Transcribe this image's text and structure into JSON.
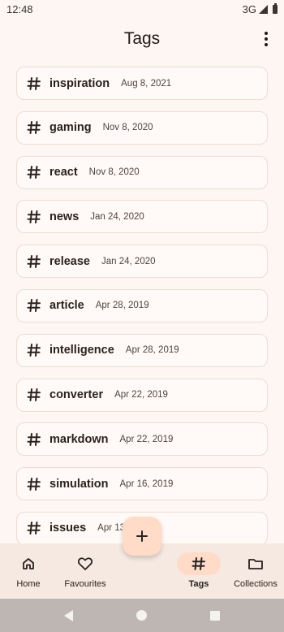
{
  "status_bar": {
    "time": "12:48",
    "network": "3G"
  },
  "app_bar": {
    "title": "Tags",
    "more_icon": "more-vert-icon"
  },
  "tags": [
    {
      "name": "inspiration",
      "date": "Aug 8, 2021"
    },
    {
      "name": "gaming",
      "date": "Nov 8, 2020"
    },
    {
      "name": "react",
      "date": "Nov 8, 2020"
    },
    {
      "name": "news",
      "date": "Jan 24, 2020"
    },
    {
      "name": "release",
      "date": "Jan 24, 2020"
    },
    {
      "name": "article",
      "date": "Apr 28, 2019"
    },
    {
      "name": "intelligence",
      "date": "Apr 28, 2019"
    },
    {
      "name": "converter",
      "date": "Apr 22, 2019"
    },
    {
      "name": "markdown",
      "date": "Apr 22, 2019"
    },
    {
      "name": "simulation",
      "date": "Apr 16, 2019"
    },
    {
      "name": "issues",
      "date": "Apr 13, 2019"
    }
  ],
  "fab": {
    "icon": "add-icon"
  },
  "bottom_nav": {
    "items": [
      {
        "label": "Home",
        "icon": "home-icon",
        "active": false
      },
      {
        "label": "Favourites",
        "icon": "heart-icon",
        "active": false
      },
      {
        "label": "",
        "icon": "",
        "active": false
      },
      {
        "label": "Tags",
        "icon": "hash-icon",
        "active": true
      },
      {
        "label": "Collections",
        "icon": "folder-icon",
        "active": false
      }
    ]
  },
  "colors": {
    "background": "#fdf6f2",
    "card_border": "#ecdcd4",
    "accent_container": "#ffdbc8",
    "nav_background": "#f6e9e1",
    "system_nav": "#bdb6b2"
  }
}
